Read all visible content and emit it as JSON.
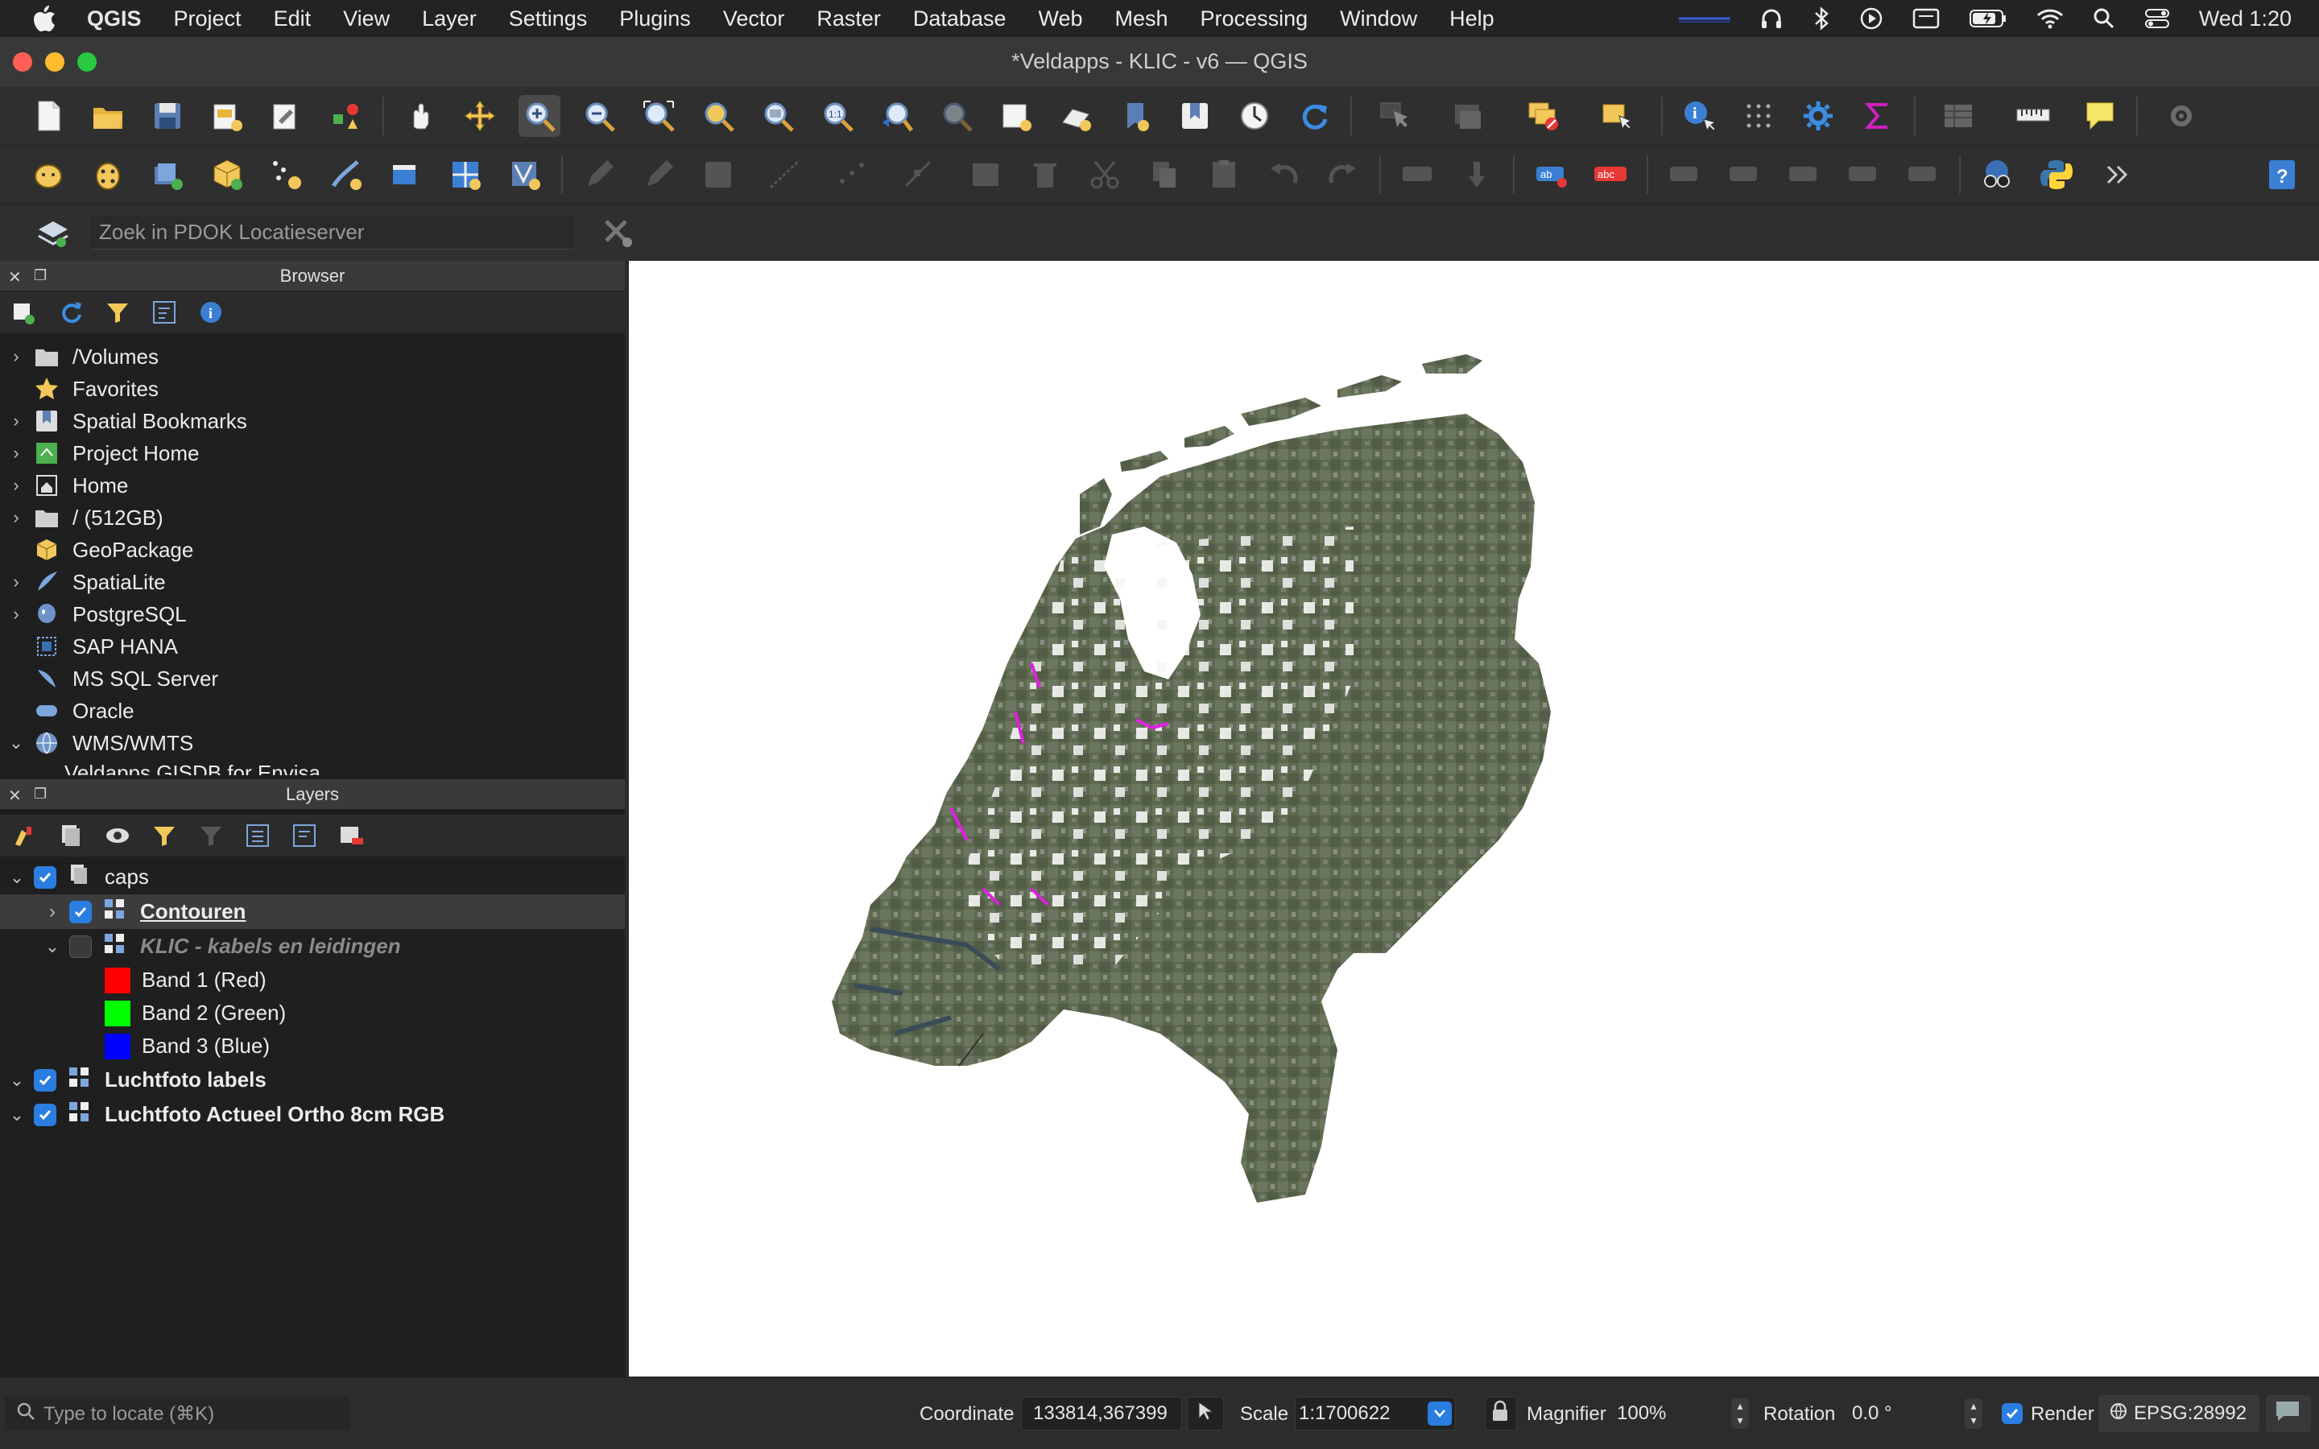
{
  "menubar": {
    "app_name": "QGIS",
    "items": [
      "Project",
      "Edit",
      "View",
      "Layer",
      "Settings",
      "Plugins",
      "Vector",
      "Raster",
      "Database",
      "Web",
      "Mesh",
      "Processing",
      "Window",
      "Help"
    ],
    "clock": "Wed  1:20"
  },
  "window": {
    "title": "*Veldapps - KLIC - v6 — QGIS"
  },
  "locator_toolbar": {
    "placeholder": "Zoek in PDOK Locatieserver"
  },
  "browser": {
    "title": "Browser",
    "items": [
      {
        "label": "/Volumes",
        "icon": "folder-icon",
        "expandable": true
      },
      {
        "label": "Favorites",
        "icon": "star-icon",
        "expandable": false
      },
      {
        "label": "Spatial Bookmarks",
        "icon": "bookmark-icon",
        "expandable": true
      },
      {
        "label": "Project Home",
        "icon": "project-home-icon",
        "expandable": true
      },
      {
        "label": "Home",
        "icon": "home-icon",
        "expandable": true
      },
      {
        "label": "/ (512GB)",
        "icon": "folder-icon",
        "expandable": true
      },
      {
        "label": "GeoPackage",
        "icon": "geopackage-icon",
        "expandable": false
      },
      {
        "label": "SpatiaLite",
        "icon": "spatialite-icon",
        "expandable": true
      },
      {
        "label": "PostgreSQL",
        "icon": "postgresql-icon",
        "expandable": true
      },
      {
        "label": "SAP HANA",
        "icon": "sap-hana-icon",
        "expandable": false
      },
      {
        "label": "MS SQL Server",
        "icon": "mssql-icon",
        "expandable": false
      },
      {
        "label": "Oracle",
        "icon": "oracle-icon",
        "expandable": false
      },
      {
        "label": "WMS/WMTS",
        "icon": "globe-icon",
        "expandable": true,
        "expanded": true
      }
    ],
    "partial_item": "Veldapps GISDB for Envisa"
  },
  "layers": {
    "title": "Layers",
    "group": {
      "name": "caps",
      "checked": true
    },
    "contouren": {
      "name": "Contouren",
      "checked": true
    },
    "klic": {
      "name": "KLIC - kabels en leidingen",
      "checked": false
    },
    "bands": [
      {
        "label": "Band 1 (Red)",
        "color": "#ff0000"
      },
      {
        "label": "Band 2 (Green)",
        "color": "#00ff00"
      },
      {
        "label": "Band 3 (Blue)",
        "color": "#0000ff"
      }
    ],
    "luchtfoto_labels": {
      "name": "Luchtfoto labels",
      "checked": true
    },
    "luchtfoto_ortho": {
      "name": "Luchtfoto Actueel Ortho 8cm RGB",
      "checked": true
    }
  },
  "statusbar": {
    "locate_placeholder": "Type to locate (⌘K)",
    "coordinate_label": "Coordinate",
    "coordinate_value": "133814,367399",
    "scale_label": "Scale",
    "scale_value": "1:1700622",
    "magnifier_label": "Magnifier",
    "magnifier_value": "100%",
    "rotation_label": "Rotation",
    "rotation_value": "0.0 °",
    "render_label": "Render",
    "render_checked": true,
    "crs": "EPSG:28992"
  },
  "colors": {
    "accent": "#2a7de1",
    "map_background": "#ffffff"
  }
}
